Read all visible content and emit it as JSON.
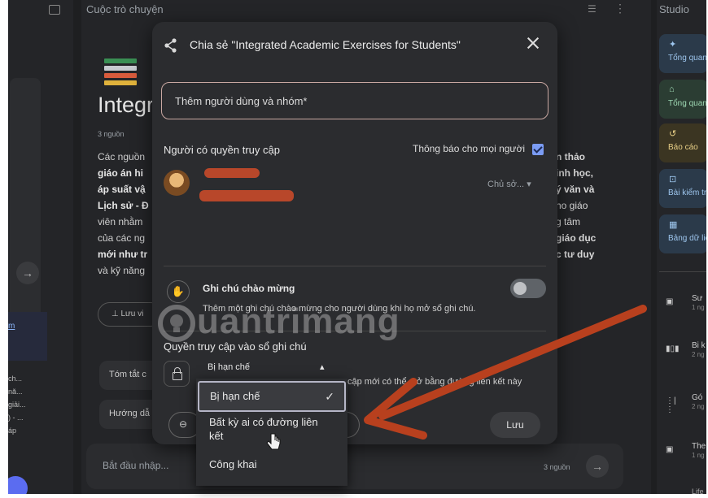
{
  "background": {
    "center_header": "Cuộc trò chuyện",
    "right_header": "Studio",
    "notebook_title": "Integr",
    "source_count": "3 nguồn",
    "summary_left_lines": [
      "Các nguồn",
      "giáo án hi",
      "áp suất vậ",
      "Lịch sử - Đ",
      "viên nhằm",
      "của các ng",
      "mới như tr",
      "và kỹ năng"
    ],
    "summary_right_lines": [
      "n thảo",
      "inh học,",
      "ý văn và",
      "ho giáo",
      "g tâm",
      "giáo dục",
      "c tư duy"
    ],
    "save_note": "Lưu vi",
    "chip_summary": "Tóm tắt c",
    "chip_guide": "Hướng dẫ",
    "chat_placeholder": "Bắt đầu nhập...",
    "chat_sources": "3 nguồn",
    "left_panel_fragments": [
      "ch...",
      "nă...",
      "giải...",
      ") - ...",
      "áp",
      "m"
    ],
    "studio_cards": [
      {
        "label": "Tổng quan",
        "bg": "#2b3a4a",
        "color": "#9ec6ee"
      },
      {
        "label": "Tổng quan",
        "bg": "#2b3d33",
        "color": "#9fdab4"
      },
      {
        "label": "Báo cáo",
        "bg": "#3b3522",
        "color": "#e8cf86"
      },
      {
        "label": "Bài kiểm tra",
        "bg": "#2b3a4a",
        "color": "#9ec6ee"
      },
      {
        "label": "Bảng dữ liệ",
        "bg": "#2b3a4a",
        "color": "#9ec6ee"
      }
    ],
    "studio_items": [
      {
        "label": "Sư",
        "sub": "1 ng"
      },
      {
        "label": "Bi k",
        "sub": "2 ng"
      },
      {
        "label": "Gó",
        "sub": "2 ng"
      },
      {
        "label": "The",
        "sub": "1 ng"
      }
    ],
    "studio_bottom": "Life"
  },
  "dialog": {
    "title": "Chia sẻ \"Integrated Academic Exercises for Students\"",
    "add_placeholder": "Thêm người dùng và nhóm*",
    "access_heading": "Người có quyền truy cập",
    "notify_label": "Thông báo cho mọi người",
    "notify_checked": true,
    "owner_role": "Chủ sở...",
    "welcome_title": "Ghi chú chào mừng",
    "welcome_desc": "Thêm một ghi chú chào mừng cho người dùng khi họ mở sổ ghi chú.",
    "welcome_enabled": false,
    "notebook_access_heading": "Quyền truy cập vào sổ ghi chú",
    "access_value": "Bị hạn chế",
    "access_hint": "cập mới có thể mở bằng đường liên kết này",
    "save_label": "Lưu"
  },
  "dropdown": {
    "options": [
      "Bị hạn chế",
      "Bất kỳ ai có đường liên kết",
      "Công khai"
    ],
    "selected": "Bị hạn chế"
  },
  "watermark": "uantrimang",
  "colors": {
    "annotation_arrow": "#b8401e",
    "checkbox": "#7b9cf4",
    "redaction": "#c84a2a"
  }
}
